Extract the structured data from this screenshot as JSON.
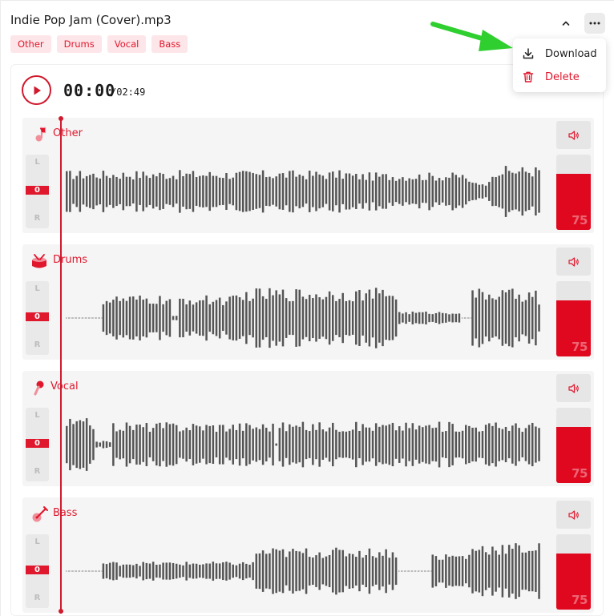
{
  "file": {
    "title": "Indie Pop Jam (Cover).mp3"
  },
  "tags": [
    "Other",
    "Drums",
    "Vocal",
    "Bass"
  ],
  "player": {
    "current_time": "00:00",
    "total_time": "/02:49"
  },
  "menu": {
    "download_label": "Download",
    "delete_label": "Delete"
  },
  "tracks": [
    {
      "name": "Other",
      "icon": "note-icon",
      "pan_left": "L",
      "pan_value": "0",
      "pan_right": "R",
      "volume": "75",
      "volume_fraction": 0.75
    },
    {
      "name": "Drums",
      "icon": "drum-icon",
      "pan_left": "L",
      "pan_value": "0",
      "pan_right": "R",
      "volume": "75",
      "volume_fraction": 0.75
    },
    {
      "name": "Vocal",
      "icon": "microphone-icon",
      "pan_left": "L",
      "pan_value": "0",
      "pan_right": "R",
      "volume": "75",
      "volume_fraction": 0.75
    },
    {
      "name": "Bass",
      "icon": "guitar-icon",
      "pan_left": "L",
      "pan_value": "0",
      "pan_right": "R",
      "volume": "75",
      "volume_fraction": 0.75
    }
  ],
  "colors": {
    "accent": "#e0182d",
    "tag_bg": "#fde6e9",
    "waveform": "#555555",
    "annotation_arrow": "#2fcf2f"
  }
}
